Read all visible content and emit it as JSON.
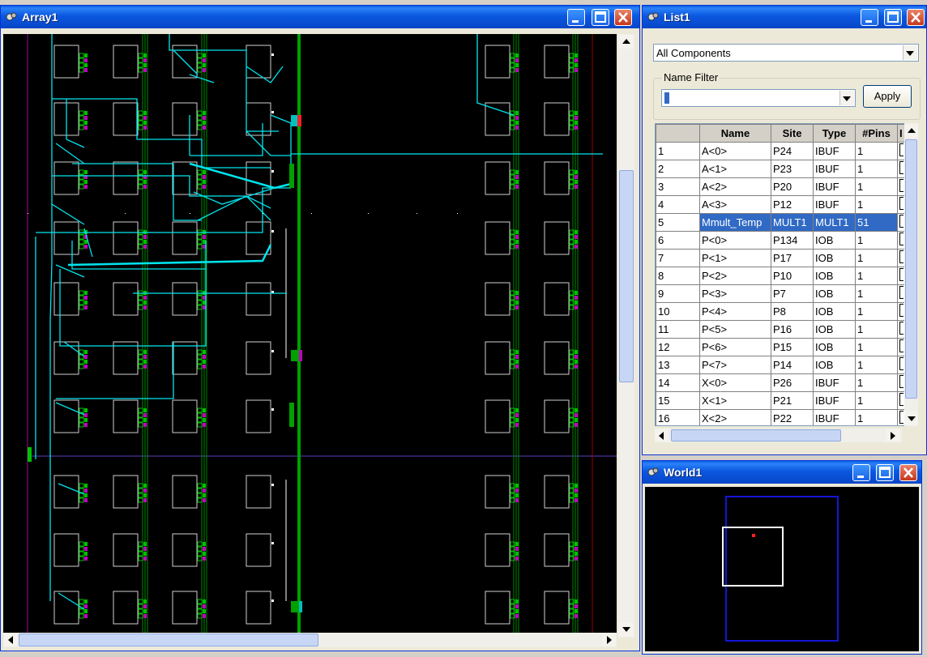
{
  "array_window": {
    "title": "Array1"
  },
  "list_window": {
    "title": "List1",
    "filter_select": "All Components",
    "name_filter_label": "Name Filter",
    "name_filter_value": "",
    "apply_label": "Apply",
    "columns": [
      "Name",
      "Site",
      "Type",
      "#Pins"
    ],
    "rows": [
      {
        "n": "1",
        "name": "A<0>",
        "site": "P24",
        "type": "IBUF",
        "pins": "1"
      },
      {
        "n": "2",
        "name": "A<1>",
        "site": "P23",
        "type": "IBUF",
        "pins": "1"
      },
      {
        "n": "3",
        "name": "A<2>",
        "site": "P20",
        "type": "IBUF",
        "pins": "1"
      },
      {
        "n": "4",
        "name": "A<3>",
        "site": "P12",
        "type": "IBUF",
        "pins": "1"
      },
      {
        "n": "5",
        "name": "Mmult_Temp",
        "site": "MULT1",
        "type": "MULT1",
        "pins": "51",
        "selected": true
      },
      {
        "n": "6",
        "name": "P<0>",
        "site": "P134",
        "type": "IOB",
        "pins": "1"
      },
      {
        "n": "7",
        "name": "P<1>",
        "site": "P17",
        "type": "IOB",
        "pins": "1"
      },
      {
        "n": "8",
        "name": "P<2>",
        "site": "P10",
        "type": "IOB",
        "pins": "1"
      },
      {
        "n": "9",
        "name": "P<3>",
        "site": "P7",
        "type": "IOB",
        "pins": "1"
      },
      {
        "n": "10",
        "name": "P<4>",
        "site": "P8",
        "type": "IOB",
        "pins": "1"
      },
      {
        "n": "11",
        "name": "P<5>",
        "site": "P16",
        "type": "IOB",
        "pins": "1"
      },
      {
        "n": "12",
        "name": "P<6>",
        "site": "P15",
        "type": "IOB",
        "pins": "1"
      },
      {
        "n": "13",
        "name": "P<7>",
        "site": "P14",
        "type": "IOB",
        "pins": "1"
      },
      {
        "n": "14",
        "name": "X<0>",
        "site": "P26",
        "type": "IBUF",
        "pins": "1"
      },
      {
        "n": "15",
        "name": "X<1>",
        "site": "P21",
        "type": "IBUF",
        "pins": "1"
      },
      {
        "n": "16",
        "name": "X<2>",
        "site": "P22",
        "type": "IBUF",
        "pins": "1"
      }
    ]
  },
  "world_window": {
    "title": "World1"
  },
  "colors": {
    "title_blue": "#0a58e0",
    "selection": "#316ac5",
    "route": "#00e5ee",
    "pin": "#00c000",
    "site": "#c000c0"
  }
}
